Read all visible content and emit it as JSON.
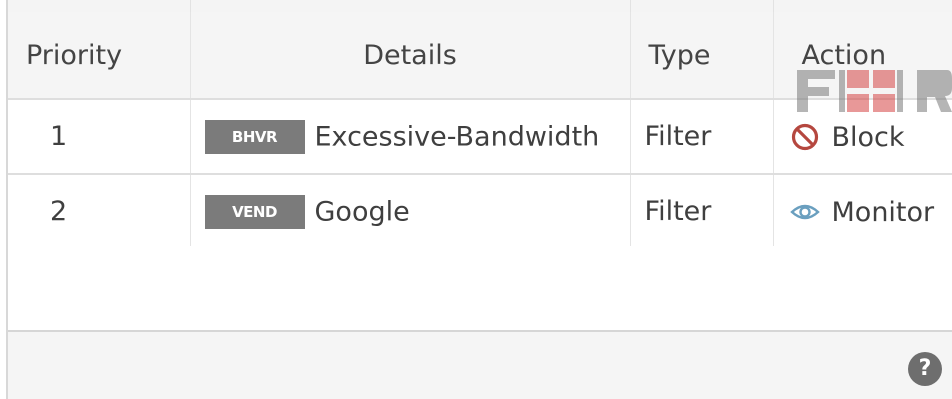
{
  "table": {
    "headers": {
      "priority": "Priority",
      "details": "Details",
      "type": "Type",
      "action": "Action"
    },
    "rows": [
      {
        "priority": "1",
        "badge": "BHVR",
        "details": "Excessive-Bandwidth",
        "type": "Filter",
        "action": "Block",
        "action_icon": "block-icon",
        "action_icon_color": "#b5473f"
      },
      {
        "priority": "2",
        "badge": "VEND",
        "details": "Google",
        "type": "Filter",
        "action": "Monitor",
        "action_icon": "eye-icon",
        "action_icon_color": "#6a9fbf"
      }
    ]
  },
  "footer": {
    "help_label": "?",
    "help_icon": "help-icon"
  },
  "watermark": {
    "logo": "FORTINET",
    "color": "#7a7a7a",
    "accent_color": "#d64545"
  },
  "colors": {
    "badge_bg": "#7b7b7b",
    "header_bg": "#f5f5f5",
    "footer_bg": "#f5f5f5"
  }
}
